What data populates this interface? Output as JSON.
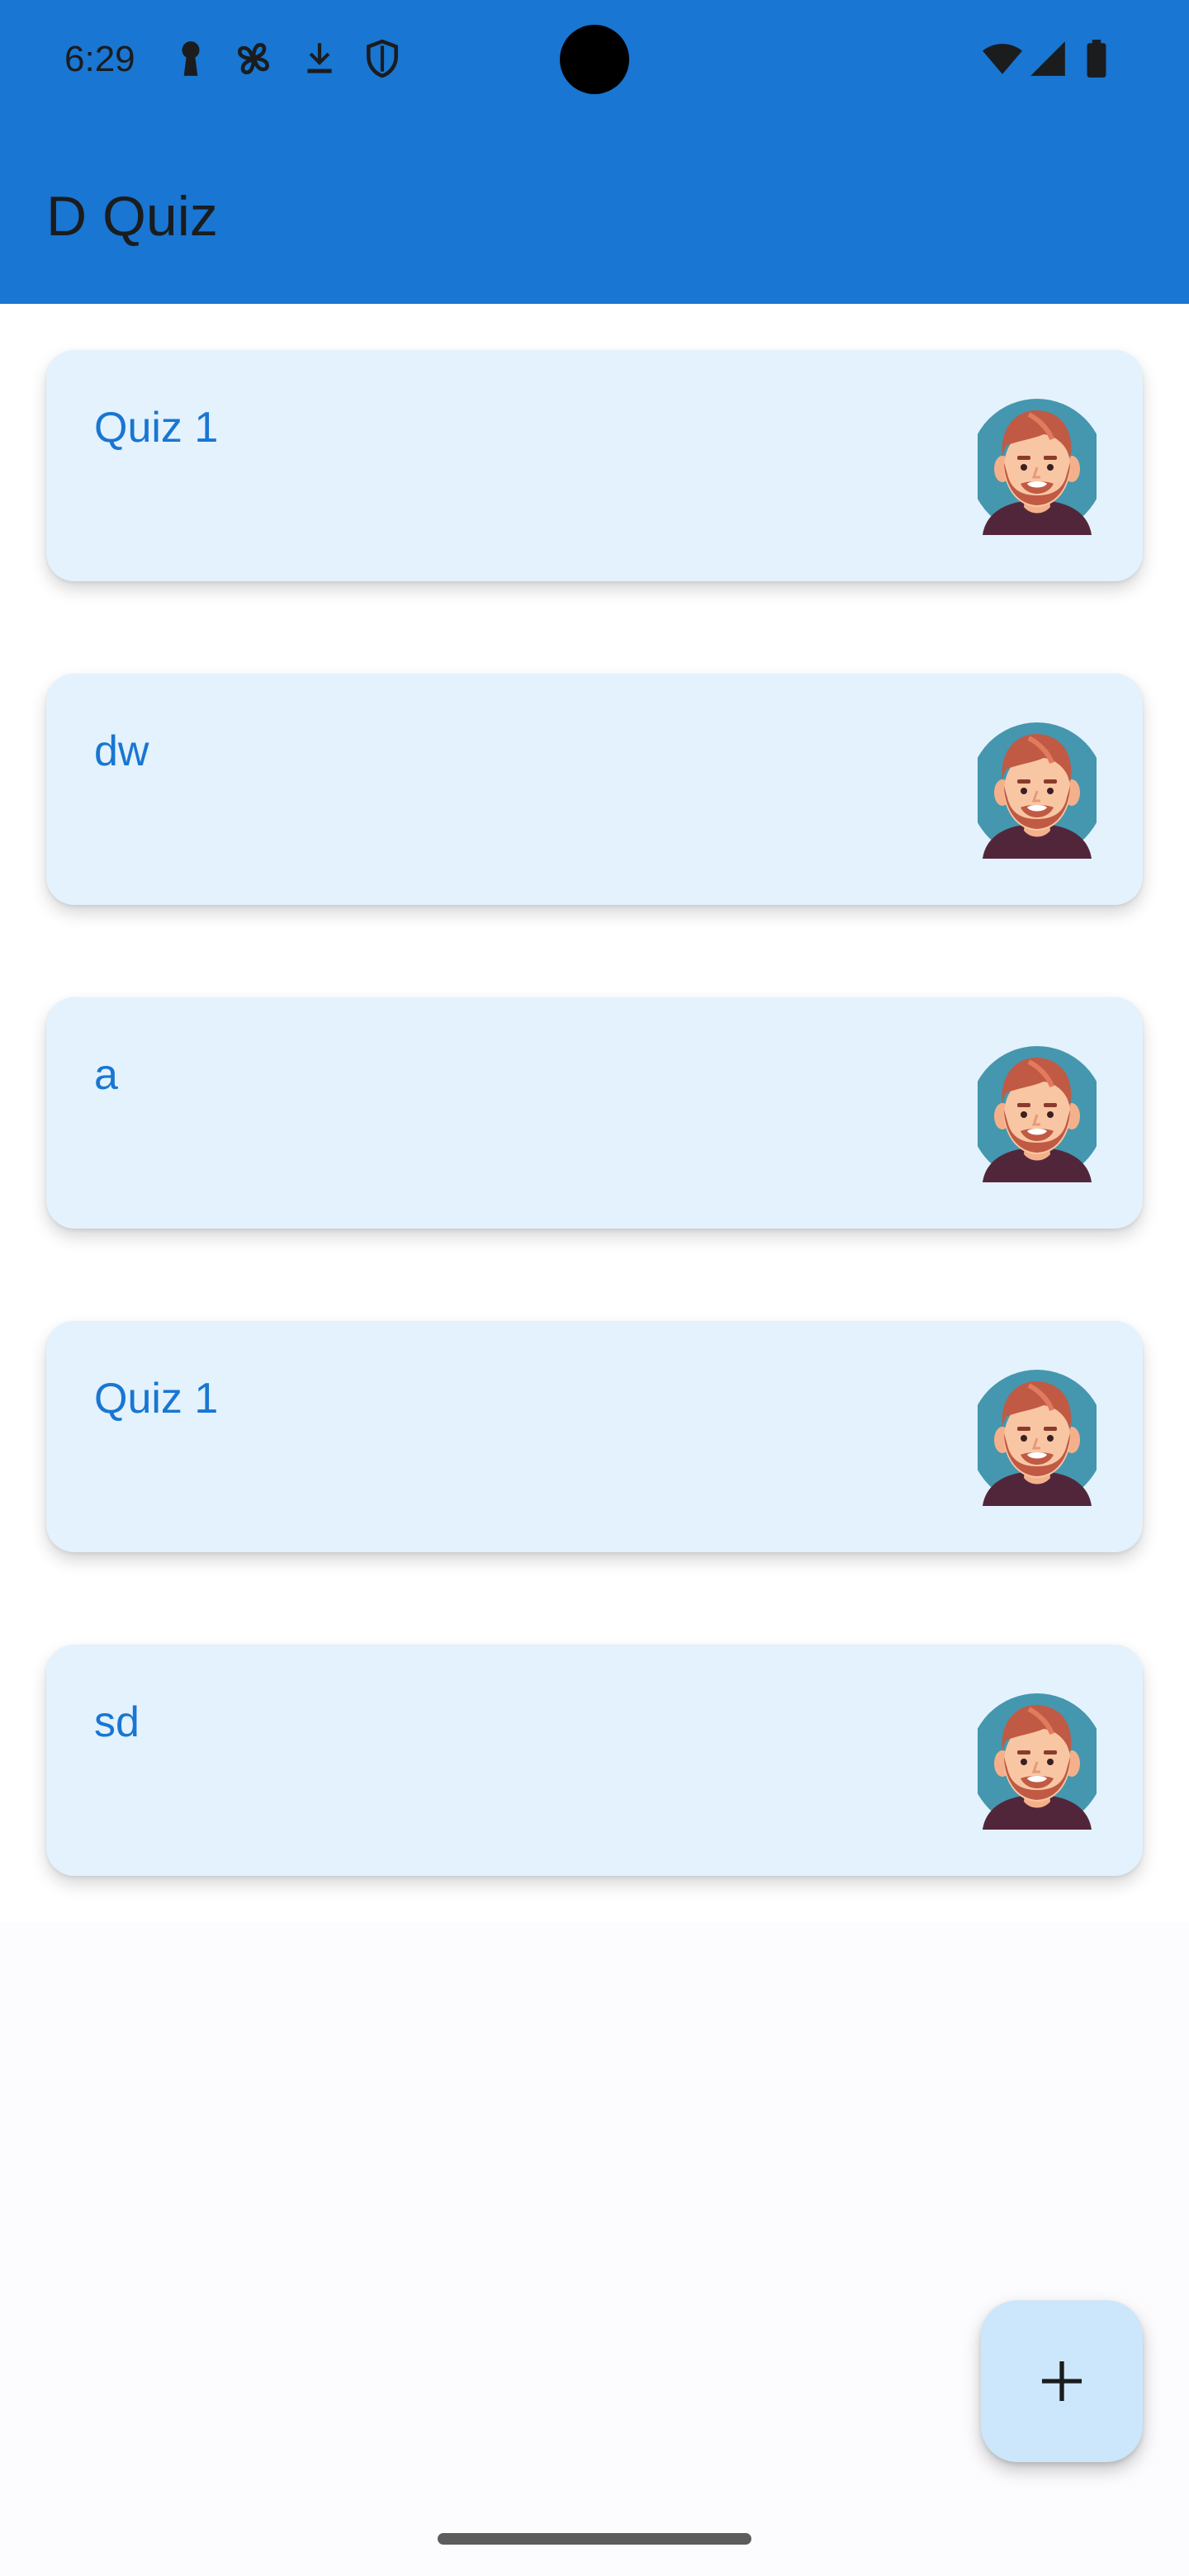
{
  "status_bar": {
    "time": "6:29",
    "left_icons": [
      "keyhole-icon",
      "fan-icon",
      "download-icon",
      "shield-icon"
    ],
    "right_icons": [
      "wifi-icon",
      "signal-icon",
      "battery-icon"
    ]
  },
  "app_bar": {
    "title": "D Quiz",
    "color": "#1976d2"
  },
  "quizzes": [
    {
      "title": "Quiz 1",
      "avatar_icon": "avatar-bearded-man-icon"
    },
    {
      "title": "dw",
      "avatar_icon": "avatar-bearded-man-icon"
    },
    {
      "title": "a",
      "avatar_icon": "avatar-bearded-man-icon"
    },
    {
      "title": "Quiz 1",
      "avatar_icon": "avatar-bearded-man-icon"
    },
    {
      "title": "sd",
      "avatar_icon": "avatar-bearded-man-icon"
    }
  ],
  "fab": {
    "icon": "plus-icon",
    "color": "#cce7fc"
  },
  "colors": {
    "card_background": "#e3f2fd",
    "card_text": "#1976d2",
    "page_background": "#fcfcff"
  }
}
